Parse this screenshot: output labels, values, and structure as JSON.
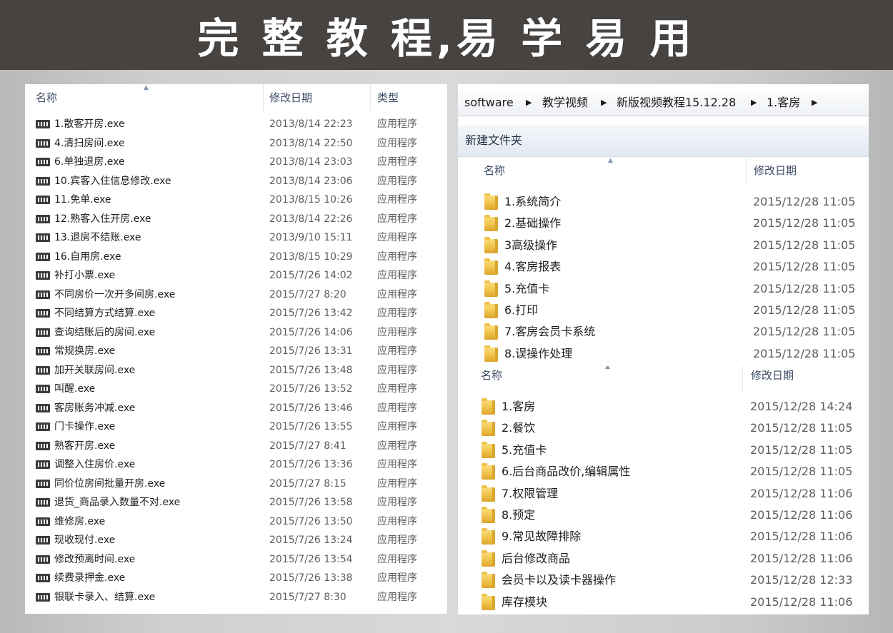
{
  "banner": {
    "title": "完 整 教 程,易 学 易 用"
  },
  "left_panel": {
    "columns": {
      "name": "名称",
      "modified": "修改日期",
      "type": "类型"
    },
    "files": [
      {
        "name": "1.散客开房.exe",
        "date": "2013/8/14 22:23",
        "type": "应用程序"
      },
      {
        "name": "4.清扫房间.exe",
        "date": "2013/8/14 22:50",
        "type": "应用程序"
      },
      {
        "name": "6.单独退房.exe",
        "date": "2013/8/14 23:03",
        "type": "应用程序"
      },
      {
        "name": "10.宾客入住信息修改.exe",
        "date": "2013/8/14 23:06",
        "type": "应用程序"
      },
      {
        "name": "11.免单.exe",
        "date": "2013/8/15 10:26",
        "type": "应用程序"
      },
      {
        "name": "12.熟客入住开房.exe",
        "date": "2013/8/14 22:26",
        "type": "应用程序"
      },
      {
        "name": "13.退房不结账.exe",
        "date": "2013/9/10 15:11",
        "type": "应用程序"
      },
      {
        "name": "16.自用房.exe",
        "date": "2013/8/15 10:29",
        "type": "应用程序"
      },
      {
        "name": "补打小票.exe",
        "date": "2015/7/26 14:02",
        "type": "应用程序"
      },
      {
        "name": "不同房价一次开多间房.exe",
        "date": "2015/7/27 8:20",
        "type": "应用程序"
      },
      {
        "name": "不同结算方式结算.exe",
        "date": "2015/7/26 13:42",
        "type": "应用程序"
      },
      {
        "name": "查询结账后的房间.exe",
        "date": "2015/7/26 14:06",
        "type": "应用程序"
      },
      {
        "name": "常规换房.exe",
        "date": "2015/7/26 13:31",
        "type": "应用程序"
      },
      {
        "name": "加开关联房间.exe",
        "date": "2015/7/26 13:48",
        "type": "应用程序"
      },
      {
        "name": "叫醒.exe",
        "date": "2015/7/26 13:52",
        "type": "应用程序"
      },
      {
        "name": "客房账务冲减.exe",
        "date": "2015/7/26 13:46",
        "type": "应用程序"
      },
      {
        "name": "门卡操作.exe",
        "date": "2015/7/26 13:55",
        "type": "应用程序"
      },
      {
        "name": "熟客开房.exe",
        "date": "2015/7/27 8:41",
        "type": "应用程序"
      },
      {
        "name": "调整入住房价.exe",
        "date": "2015/7/26 13:36",
        "type": "应用程序"
      },
      {
        "name": "同价位房间批量开房.exe",
        "date": "2015/7/27 8:15",
        "type": "应用程序"
      },
      {
        "name": "退货_商品录入数量不对.exe",
        "date": "2015/7/26 13:58",
        "type": "应用程序"
      },
      {
        "name": "维修房.exe",
        "date": "2015/7/26 13:50",
        "type": "应用程序"
      },
      {
        "name": "现收现付.exe",
        "date": "2015/7/26 13:24",
        "type": "应用程序"
      },
      {
        "name": "修改预离时间.exe",
        "date": "2015/7/26 13:54",
        "type": "应用程序"
      },
      {
        "name": "续费录押金.exe",
        "date": "2015/7/26 13:38",
        "type": "应用程序"
      },
      {
        "name": "银联卡录入、结算.exe",
        "date": "2015/7/27 8:30",
        "type": "应用程序"
      }
    ]
  },
  "right_top": {
    "breadcrumb": [
      "software",
      "教学视频",
      "新版视频教程15.12.28",
      "1.客房"
    ],
    "new_folder_label": "新建文件夹",
    "columns": {
      "name": "名称",
      "modified": "修改日期"
    },
    "folders": [
      {
        "name": "1.系统简介",
        "date": "2015/12/28 11:05"
      },
      {
        "name": "2.基础操作",
        "date": "2015/12/28 11:05"
      },
      {
        "name": "3高级操作",
        "date": "2015/12/28 11:05"
      },
      {
        "name": "4.客房报表",
        "date": "2015/12/28 11:05"
      },
      {
        "name": "5.充值卡",
        "date": "2015/12/28 11:05"
      },
      {
        "name": "6.打印",
        "date": "2015/12/28 11:05"
      },
      {
        "name": "7.客房会员卡系统",
        "date": "2015/12/28 11:05"
      },
      {
        "name": "8.误操作处理",
        "date": "2015/12/28 11:05"
      }
    ]
  },
  "right_bottom": {
    "columns": {
      "name": "名称",
      "modified": "修改日期"
    },
    "folders": [
      {
        "name": "1.客房",
        "date": "2015/12/28 14:24"
      },
      {
        "name": "2.餐饮",
        "date": "2015/12/28 11:05"
      },
      {
        "name": "5.充值卡",
        "date": "2015/12/28 11:05"
      },
      {
        "name": "6.后台商品改价,编辑属性",
        "date": "2015/12/28 11:05"
      },
      {
        "name": "7.权限管理",
        "date": "2015/12/28 11:06"
      },
      {
        "name": "8.预定",
        "date": "2015/12/28 11:06"
      },
      {
        "name": "9.常见故障排除",
        "date": "2015/12/28 11:06"
      },
      {
        "name": "后台修改商品",
        "date": "2015/12/28 11:06"
      },
      {
        "name": "会员卡以及读卡器操作",
        "date": "2015/12/28 12:33"
      },
      {
        "name": "库存模块",
        "date": "2015/12/28 11:06"
      }
    ]
  }
}
